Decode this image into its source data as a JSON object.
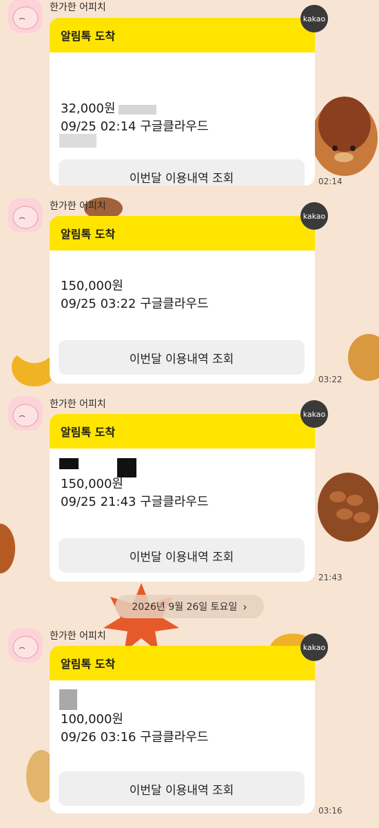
{
  "sender_name": "한가한 어피치",
  "card_title": "알림톡 도착",
  "button_label": "이번달 이용내역 조회",
  "badge_label": "kakao",
  "date_divider": "2026년 9월 26일 토요일",
  "chevron": "›",
  "colors": {
    "background": "#f8e4d2",
    "card_header": "#ffe400",
    "badge": "#3a3a3a",
    "button": "#efefef"
  },
  "messages": [
    {
      "amount": "32,000원",
      "detail": "09/25 02:14 구글클라우드",
      "time": "02:14"
    },
    {
      "amount": "150,000원",
      "detail": "09/25 03:22 구글클라우드",
      "time": "03:22"
    },
    {
      "amount": "150,000원",
      "detail": "09/25 21:43 구글클라우드",
      "time": "21:43"
    },
    {
      "amount": "100,000원",
      "detail": "09/26 03:16 구글클라우드",
      "time": "03:16"
    }
  ]
}
